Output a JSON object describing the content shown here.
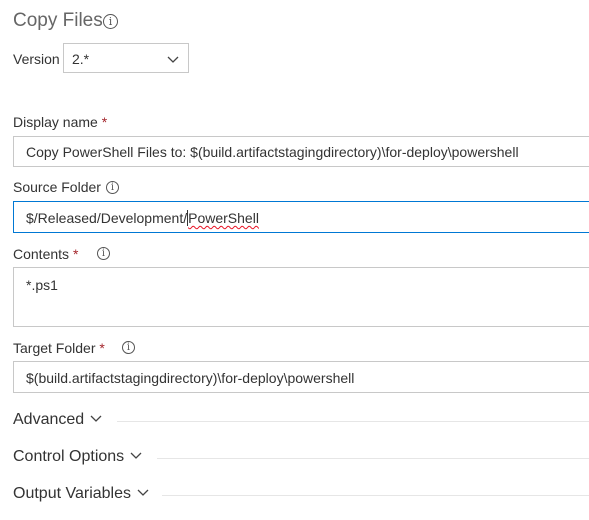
{
  "task": {
    "title": "Copy Files",
    "version_label": "Version",
    "version_value": "2.*"
  },
  "display_name": {
    "label": "Display name",
    "required": "*",
    "value": "Copy PowerShell Files to: $(build.artifactstagingdirectory)\\for-deploy\\powershell"
  },
  "source_folder": {
    "label": "Source Folder",
    "value_prefix": "$/Released/Development/",
    "value_suffix": "PowerShell"
  },
  "contents": {
    "label": "Contents",
    "required": "*",
    "value": "*.ps1"
  },
  "target_folder": {
    "label": "Target Folder",
    "required": "*",
    "value": "$(build.artifactstagingdirectory)\\for-deploy\\powershell"
  },
  "sections": [
    {
      "label": "Advanced"
    },
    {
      "label": "Control Options"
    },
    {
      "label": "Output Variables"
    }
  ],
  "icons": {
    "info": "info-icon",
    "chevron": "chevron-down-icon"
  },
  "colors": {
    "accent": "#0078d4",
    "required": "#a4262c",
    "border": "#c8c8c8"
  }
}
